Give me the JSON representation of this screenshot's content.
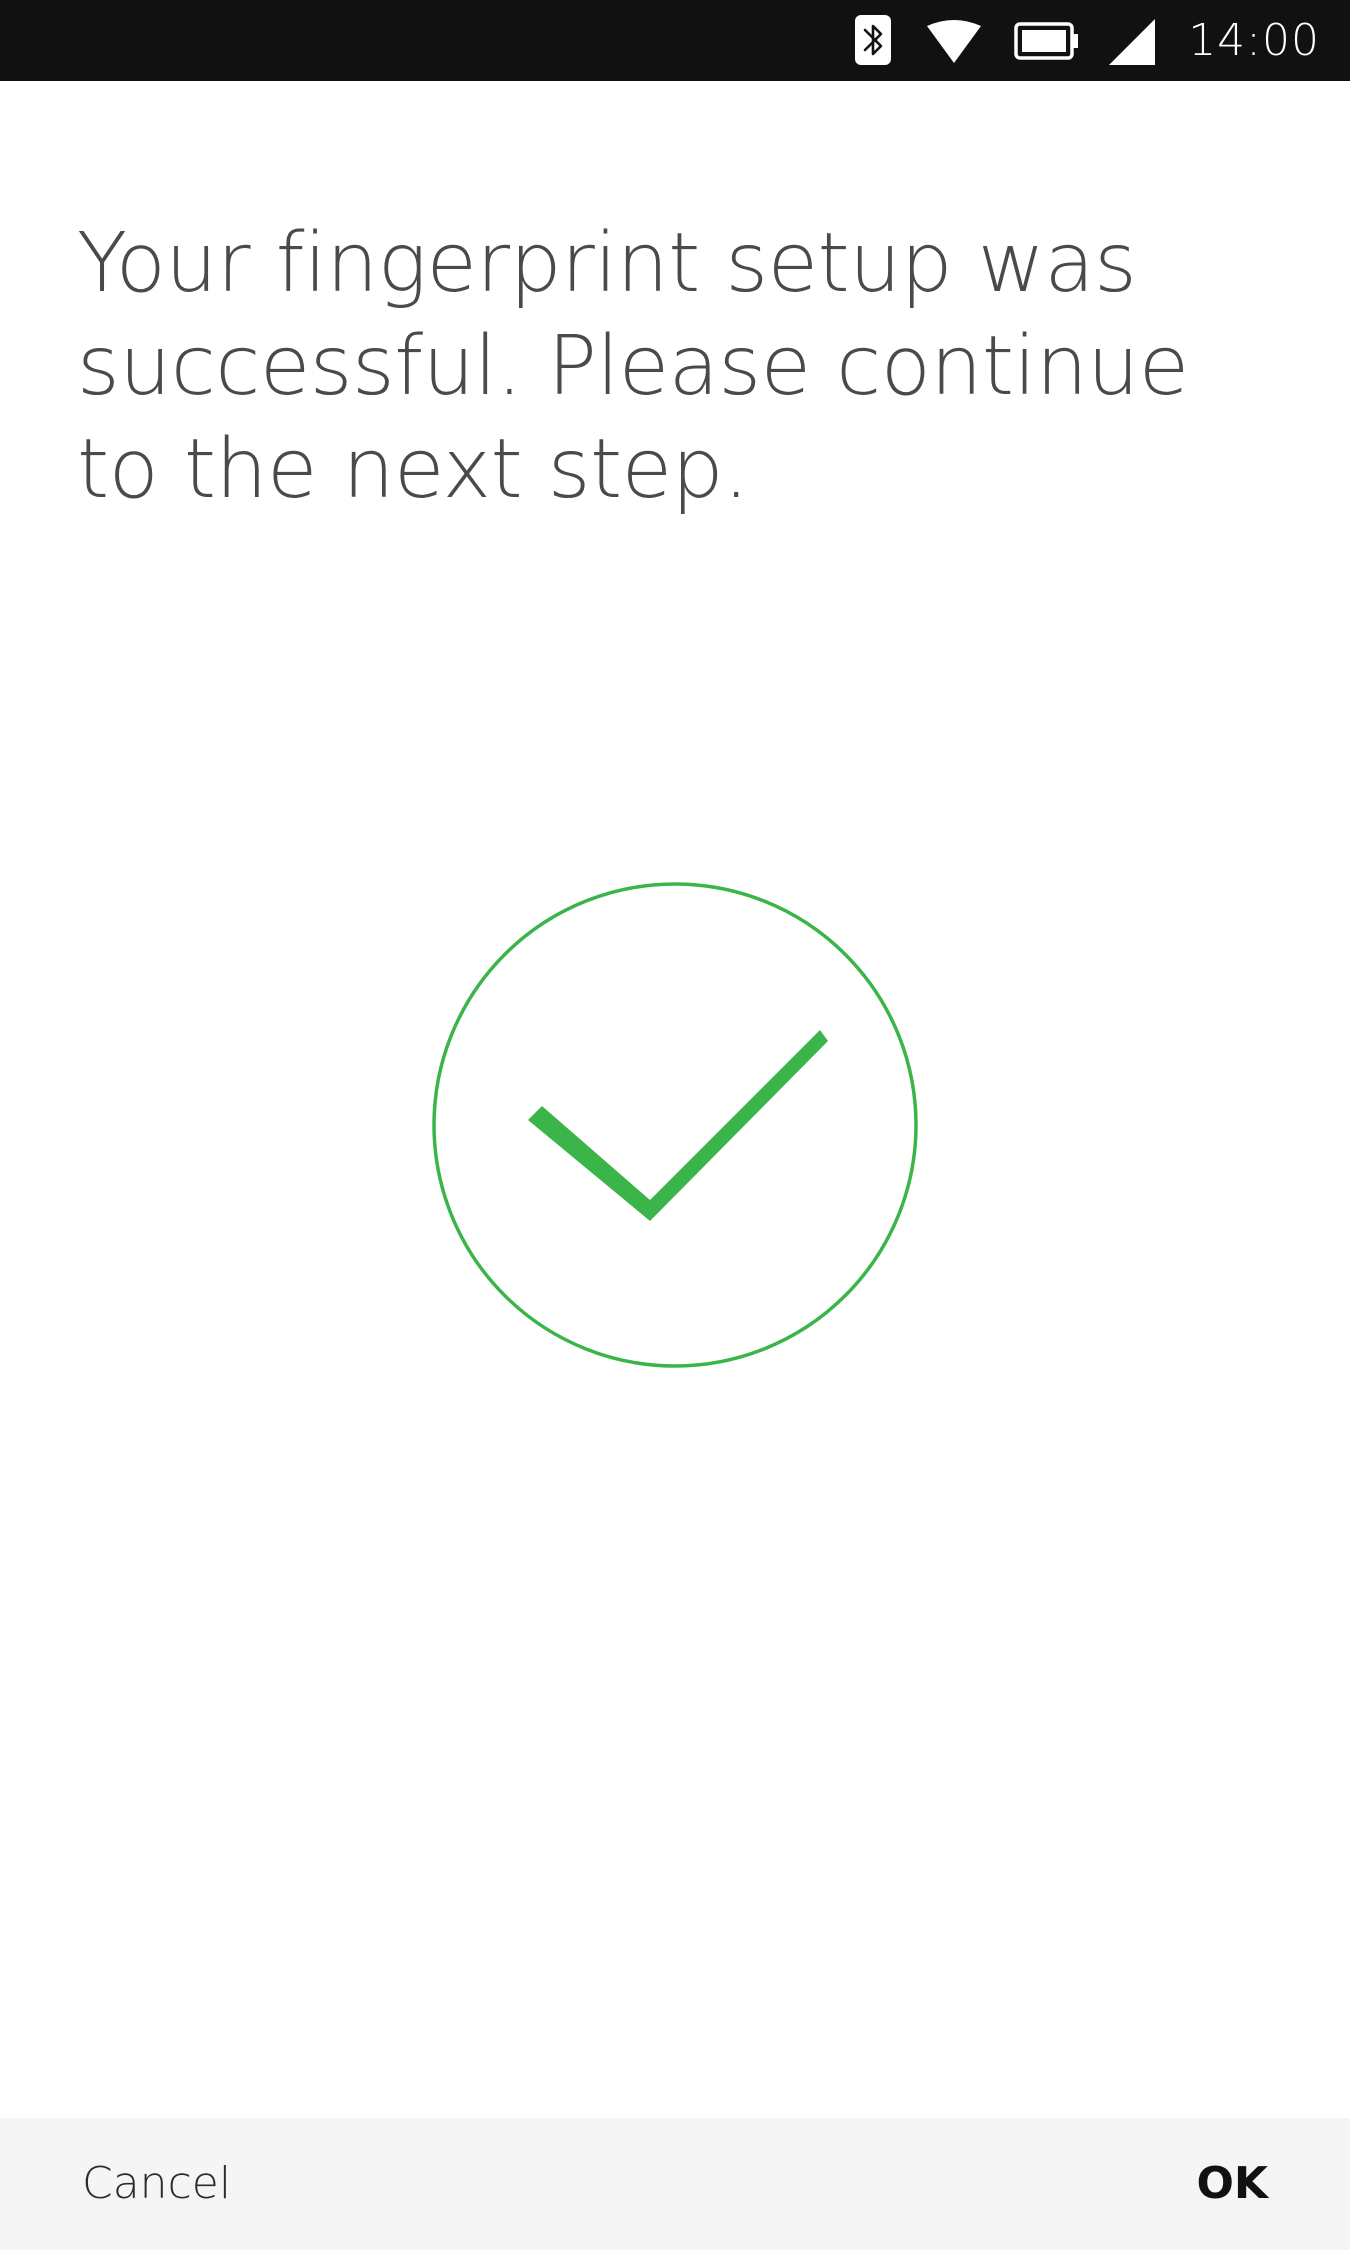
{
  "status_bar": {
    "time": "14:00",
    "icons": [
      "bluetooth-icon",
      "wifi-icon",
      "battery-icon",
      "cellular-signal-icon"
    ]
  },
  "main": {
    "message": "Your fingerprint setup was successful. Please continue to the next step.",
    "status_icon": "checkmark-circle-icon"
  },
  "footer": {
    "cancel_label": "Cancel",
    "ok_label": "OK"
  },
  "colors": {
    "status_bar_bg": "#111111",
    "success_green": "#3bb54a",
    "text": "#4a4a4a",
    "footer_bg": "#f5f5f5"
  }
}
